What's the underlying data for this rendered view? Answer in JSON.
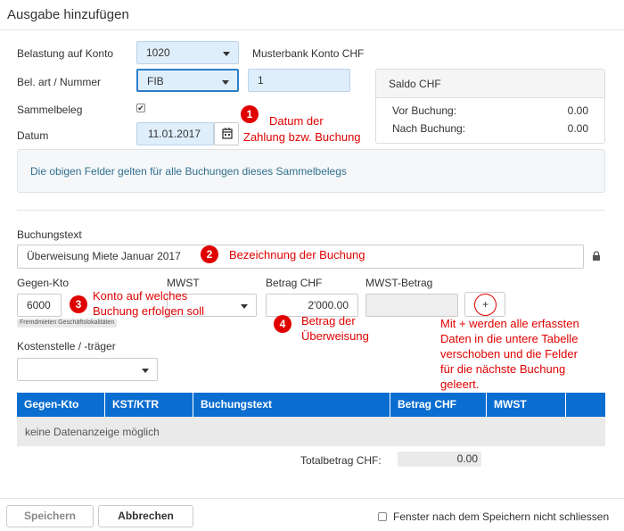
{
  "dialog": {
    "title": "Ausgabe hinzufügen"
  },
  "form": {
    "konto_label": "Belastung auf Konto",
    "konto_value": "1020",
    "konto_name": "Musterbank Konto CHF",
    "belart_label": "Bel. art / Nummer",
    "belart_value": "FIB",
    "nummer_value": "1",
    "sammelbeleg_label": "Sammelbeleg",
    "sammelbeleg_checked": "✔",
    "datum_label": "Datum",
    "datum_value": "11.01.2017",
    "info_text": "Die obigen Felder gelten für alle Buchungen dieses Sammelbelegs",
    "buchungstext_label": "Buchungstext",
    "buchungstext_value": "Überweisung Miete Januar 2017",
    "gegenkto_label": "Gegen-Kto",
    "gegenkto_value": "6000",
    "gegenkto_tag": "Fremdmieten Geschäftslokalitäten",
    "mwst_label": "MWST",
    "betrag_label": "Betrag CHF",
    "betrag_value": "2'000.00",
    "mwst_betrag_label": "MWST-Betrag",
    "add_label": "+",
    "kostenstelle_label": "Kostenstelle / -träger"
  },
  "saldo": {
    "title": "Saldo CHF",
    "vor_label": "Vor Buchung:",
    "vor_value": "0.00",
    "nach_label": "Nach Buchung:",
    "nach_value": "0.00"
  },
  "table": {
    "headers": [
      "Gegen-Kto",
      "KST/KTR",
      "Buchungstext",
      "Betrag CHF",
      "MWST"
    ],
    "empty_text": "keine Datenanzeige möglich",
    "total_label": "Totalbetrag CHF:",
    "total_value": "0.00"
  },
  "annotations": {
    "a1_num": "1",
    "a1_l1": "Datum der",
    "a1_l2": "Zahlung bzw. Buchung",
    "a2_num": "2",
    "a2_text": "Bezeichnung der Buchung",
    "a3_num": "3",
    "a3_l1": "Konto auf welches",
    "a3_l2": "Buchung erfolgen soll",
    "a4_num": "4",
    "a4_l1": "Betrag der",
    "a4_l2": "Überweisung",
    "plus_l1": "Mit + werden alle erfassten",
    "plus_l2": "Daten in die untere Tabelle",
    "plus_l3": "verschoben und die Felder",
    "plus_l4": "für die nächste Buchung",
    "plus_l5": "geleert."
  },
  "footer": {
    "save_label": "Speichern",
    "cancel_label": "Abbrechen",
    "keep_open_label": "Fenster nach dem Speichern nicht schliessen"
  },
  "colors": {
    "table_header": "#0a6ed1",
    "annotation_red": "#e00000",
    "field_blue": "#dfeefb"
  }
}
